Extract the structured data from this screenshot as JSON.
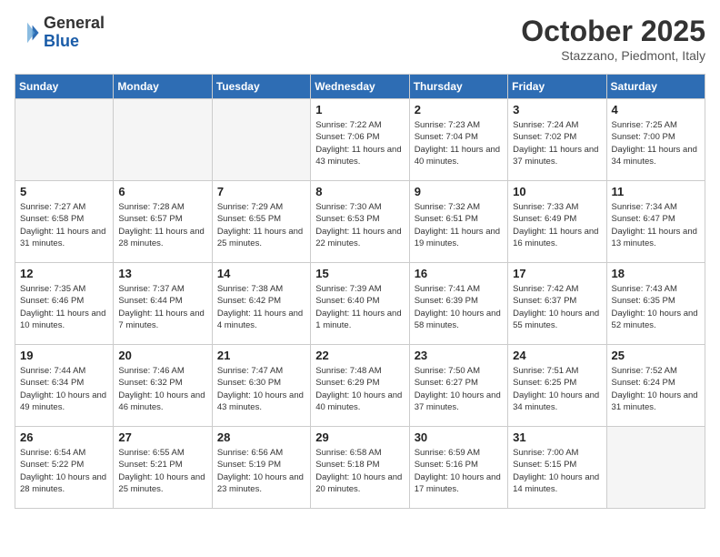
{
  "logo": {
    "text_general": "General",
    "text_blue": "Blue"
  },
  "header": {
    "month": "October 2025",
    "location": "Stazzano, Piedmont, Italy"
  },
  "weekdays": [
    "Sunday",
    "Monday",
    "Tuesday",
    "Wednesday",
    "Thursday",
    "Friday",
    "Saturday"
  ],
  "weeks": [
    [
      {
        "day": "",
        "info": ""
      },
      {
        "day": "",
        "info": ""
      },
      {
        "day": "",
        "info": ""
      },
      {
        "day": "1",
        "info": "Sunrise: 7:22 AM\nSunset: 7:06 PM\nDaylight: 11 hours and 43 minutes."
      },
      {
        "day": "2",
        "info": "Sunrise: 7:23 AM\nSunset: 7:04 PM\nDaylight: 11 hours and 40 minutes."
      },
      {
        "day": "3",
        "info": "Sunrise: 7:24 AM\nSunset: 7:02 PM\nDaylight: 11 hours and 37 minutes."
      },
      {
        "day": "4",
        "info": "Sunrise: 7:25 AM\nSunset: 7:00 PM\nDaylight: 11 hours and 34 minutes."
      }
    ],
    [
      {
        "day": "5",
        "info": "Sunrise: 7:27 AM\nSunset: 6:58 PM\nDaylight: 11 hours and 31 minutes."
      },
      {
        "day": "6",
        "info": "Sunrise: 7:28 AM\nSunset: 6:57 PM\nDaylight: 11 hours and 28 minutes."
      },
      {
        "day": "7",
        "info": "Sunrise: 7:29 AM\nSunset: 6:55 PM\nDaylight: 11 hours and 25 minutes."
      },
      {
        "day": "8",
        "info": "Sunrise: 7:30 AM\nSunset: 6:53 PM\nDaylight: 11 hours and 22 minutes."
      },
      {
        "day": "9",
        "info": "Sunrise: 7:32 AM\nSunset: 6:51 PM\nDaylight: 11 hours and 19 minutes."
      },
      {
        "day": "10",
        "info": "Sunrise: 7:33 AM\nSunset: 6:49 PM\nDaylight: 11 hours and 16 minutes."
      },
      {
        "day": "11",
        "info": "Sunrise: 7:34 AM\nSunset: 6:47 PM\nDaylight: 11 hours and 13 minutes."
      }
    ],
    [
      {
        "day": "12",
        "info": "Sunrise: 7:35 AM\nSunset: 6:46 PM\nDaylight: 11 hours and 10 minutes."
      },
      {
        "day": "13",
        "info": "Sunrise: 7:37 AM\nSunset: 6:44 PM\nDaylight: 11 hours and 7 minutes."
      },
      {
        "day": "14",
        "info": "Sunrise: 7:38 AM\nSunset: 6:42 PM\nDaylight: 11 hours and 4 minutes."
      },
      {
        "day": "15",
        "info": "Sunrise: 7:39 AM\nSunset: 6:40 PM\nDaylight: 11 hours and 1 minute."
      },
      {
        "day": "16",
        "info": "Sunrise: 7:41 AM\nSunset: 6:39 PM\nDaylight: 10 hours and 58 minutes."
      },
      {
        "day": "17",
        "info": "Sunrise: 7:42 AM\nSunset: 6:37 PM\nDaylight: 10 hours and 55 minutes."
      },
      {
        "day": "18",
        "info": "Sunrise: 7:43 AM\nSunset: 6:35 PM\nDaylight: 10 hours and 52 minutes."
      }
    ],
    [
      {
        "day": "19",
        "info": "Sunrise: 7:44 AM\nSunset: 6:34 PM\nDaylight: 10 hours and 49 minutes."
      },
      {
        "day": "20",
        "info": "Sunrise: 7:46 AM\nSunset: 6:32 PM\nDaylight: 10 hours and 46 minutes."
      },
      {
        "day": "21",
        "info": "Sunrise: 7:47 AM\nSunset: 6:30 PM\nDaylight: 10 hours and 43 minutes."
      },
      {
        "day": "22",
        "info": "Sunrise: 7:48 AM\nSunset: 6:29 PM\nDaylight: 10 hours and 40 minutes."
      },
      {
        "day": "23",
        "info": "Sunrise: 7:50 AM\nSunset: 6:27 PM\nDaylight: 10 hours and 37 minutes."
      },
      {
        "day": "24",
        "info": "Sunrise: 7:51 AM\nSunset: 6:25 PM\nDaylight: 10 hours and 34 minutes."
      },
      {
        "day": "25",
        "info": "Sunrise: 7:52 AM\nSunset: 6:24 PM\nDaylight: 10 hours and 31 minutes."
      }
    ],
    [
      {
        "day": "26",
        "info": "Sunrise: 6:54 AM\nSunset: 5:22 PM\nDaylight: 10 hours and 28 minutes."
      },
      {
        "day": "27",
        "info": "Sunrise: 6:55 AM\nSunset: 5:21 PM\nDaylight: 10 hours and 25 minutes."
      },
      {
        "day": "28",
        "info": "Sunrise: 6:56 AM\nSunset: 5:19 PM\nDaylight: 10 hours and 23 minutes."
      },
      {
        "day": "29",
        "info": "Sunrise: 6:58 AM\nSunset: 5:18 PM\nDaylight: 10 hours and 20 minutes."
      },
      {
        "day": "30",
        "info": "Sunrise: 6:59 AM\nSunset: 5:16 PM\nDaylight: 10 hours and 17 minutes."
      },
      {
        "day": "31",
        "info": "Sunrise: 7:00 AM\nSunset: 5:15 PM\nDaylight: 10 hours and 14 minutes."
      },
      {
        "day": "",
        "info": ""
      }
    ]
  ]
}
